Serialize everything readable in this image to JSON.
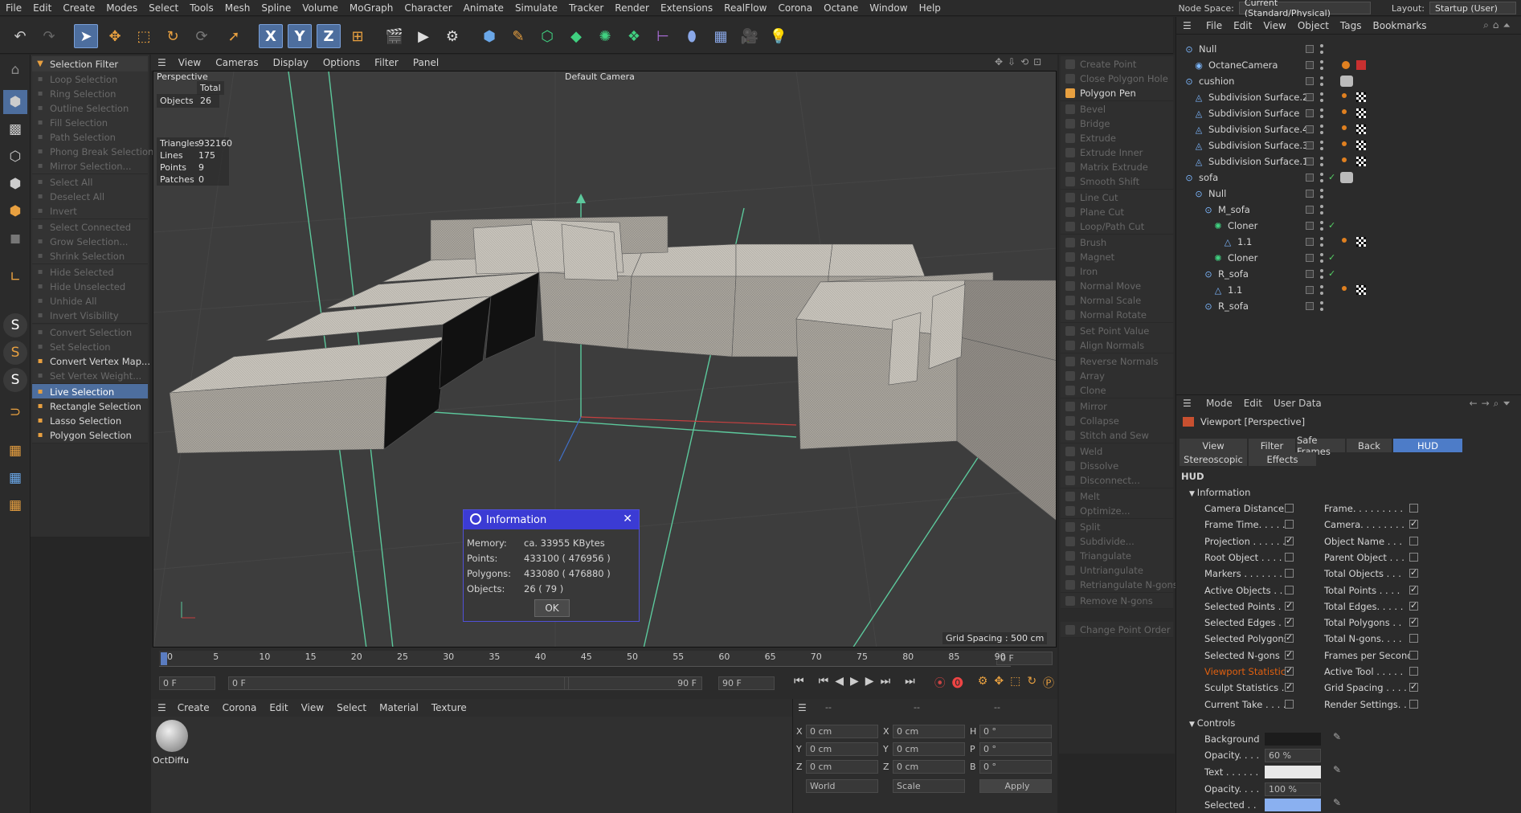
{
  "menu": [
    "File",
    "Edit",
    "Create",
    "Modes",
    "Select",
    "Tools",
    "Mesh",
    "Spline",
    "Volume",
    "MoGraph",
    "Character",
    "Animate",
    "Simulate",
    "Tracker",
    "Render",
    "Extensions",
    "RealFlow",
    "Corona",
    "Octane",
    "Window",
    "Help"
  ],
  "nodespace": {
    "label": "Node Space:",
    "value": "Current (Standard/Physical)"
  },
  "layout": {
    "label": "Layout:",
    "value": "Startup (User)"
  },
  "selection": {
    "filter": "Selection Filter",
    "items": [
      {
        "label": "Loop Selection",
        "state": "dis"
      },
      {
        "label": "Ring Selection",
        "state": "dis"
      },
      {
        "label": "Outline Selection",
        "state": "dis"
      },
      {
        "label": "Fill Selection",
        "state": "dis"
      },
      {
        "label": "Path Selection",
        "state": "dis"
      },
      {
        "label": "Phong Break Selection",
        "state": "dis"
      },
      {
        "label": "Mirror Selection...",
        "state": "dis"
      },
      {
        "label": "Select All",
        "state": "dis"
      },
      {
        "label": "Deselect All",
        "state": "dis"
      },
      {
        "label": "Invert",
        "state": "dis"
      },
      {
        "label": "Select Connected",
        "state": "dis"
      },
      {
        "label": "Grow Selection...",
        "state": "dis"
      },
      {
        "label": "Shrink Selection",
        "state": "dis"
      },
      {
        "label": "Hide Selected",
        "state": "dis"
      },
      {
        "label": "Hide Unselected",
        "state": "dis"
      },
      {
        "label": "Unhide All",
        "state": "dis"
      },
      {
        "label": "Invert Visibility",
        "state": "dis"
      },
      {
        "label": "Convert Selection",
        "state": "dis"
      },
      {
        "label": "Set Selection",
        "state": "dis"
      },
      {
        "label": "Convert Vertex Map...",
        "state": "en"
      },
      {
        "label": "Set Vertex Weight...",
        "state": "dis"
      },
      {
        "label": "Live Selection",
        "state": "act"
      },
      {
        "label": "Rectangle Selection",
        "state": "en"
      },
      {
        "label": "Lasso Selection",
        "state": "en"
      },
      {
        "label": "Polygon Selection",
        "state": "en"
      }
    ]
  },
  "viewmenu": [
    "View",
    "Cameras",
    "Display",
    "Options",
    "Filter",
    "Panel"
  ],
  "viewport": {
    "name": "Perspective",
    "camera": "Default Camera",
    "total_label": "Total",
    "objects_label": "Objects",
    "objects": "26",
    "triangles_label": "Triangles",
    "triangles": "932160",
    "lines_label": "Lines",
    "lines": "175",
    "points_label": "Points",
    "points": "9",
    "patches_label": "Patches",
    "patches": "0",
    "grid": "Grid Spacing : 500 cm"
  },
  "dialog": {
    "title": "Information",
    "memory_label": "Memory:",
    "memory": "ca. 33955 KBytes",
    "points_label": "Points:",
    "points": "433100 ( 476956 )",
    "polygons_label": "Polygons:",
    "polygons": "433080 ( 476880 )",
    "objects_label": "Objects:",
    "objects": "26 ( 79 )",
    "ok": "OK"
  },
  "timeline": {
    "ticks": [
      "0",
      "5",
      "10",
      "15",
      "20",
      "25",
      "30",
      "35",
      "40",
      "45",
      "50",
      "55",
      "60",
      "65",
      "70",
      "75",
      "80",
      "85",
      "90"
    ],
    "current": "0 F",
    "start": "0 F",
    "start2": "0 F",
    "end": "90 F",
    "end2": "90 F"
  },
  "matmenu": [
    "Create",
    "Corona",
    "Edit",
    "View",
    "Select",
    "Material",
    "Texture"
  ],
  "material": {
    "name": "OctDiffu"
  },
  "coords": {
    "x": "0 cm",
    "y": "0 cm",
    "z": "0 cm",
    "sx": "0 cm",
    "sy": "0 cm",
    "sz": "0 cm",
    "h": "0 °",
    "p": "0 °",
    "b": "0 °",
    "world": "World",
    "scale": "Scale",
    "apply": "Apply",
    "dash1": "--",
    "dash2": "--",
    "dash3": "--"
  },
  "tools": [
    {
      "label": "Create Point",
      "en": false
    },
    {
      "label": "Close Polygon Hole",
      "en": false
    },
    {
      "label": "Polygon Pen",
      "en": true
    },
    {
      "label": "Bevel",
      "en": false
    },
    {
      "label": "Bridge",
      "en": false
    },
    {
      "label": "Extrude",
      "en": false
    },
    {
      "label": "Extrude Inner",
      "en": false
    },
    {
      "label": "Matrix Extrude",
      "en": false
    },
    {
      "label": "Smooth Shift",
      "en": false
    },
    {
      "label": "Line Cut",
      "en": false
    },
    {
      "label": "Plane Cut",
      "en": false
    },
    {
      "label": "Loop/Path Cut",
      "en": false
    },
    {
      "label": "Brush",
      "en": false
    },
    {
      "label": "Magnet",
      "en": false
    },
    {
      "label": "Iron",
      "en": false
    },
    {
      "label": "Normal Move",
      "en": false
    },
    {
      "label": "Normal Scale",
      "en": false
    },
    {
      "label": "Normal Rotate",
      "en": false
    },
    {
      "label": "Set Point Value",
      "en": false
    },
    {
      "label": "Align Normals",
      "en": false
    },
    {
      "label": "Reverse Normals",
      "en": false
    },
    {
      "label": "Array",
      "en": false
    },
    {
      "label": "Clone",
      "en": false
    },
    {
      "label": "Mirror",
      "en": false
    },
    {
      "label": "Collapse",
      "en": false
    },
    {
      "label": "Stitch and Sew",
      "en": false
    },
    {
      "label": "Weld",
      "en": false
    },
    {
      "label": "Dissolve",
      "en": false
    },
    {
      "label": "Disconnect...",
      "en": false
    },
    {
      "label": "Melt",
      "en": false
    },
    {
      "label": "Optimize...",
      "en": false
    },
    {
      "label": "Split",
      "en": false
    },
    {
      "label": "Subdivide...",
      "en": false
    },
    {
      "label": "Triangulate",
      "en": false
    },
    {
      "label": "Untriangulate",
      "en": false
    },
    {
      "label": "Retriangulate N-gons",
      "en": false
    },
    {
      "label": "Remove N-gons",
      "en": false
    },
    {
      "label": "Change Point Order",
      "en": false
    }
  ],
  "objmenu": [
    "File",
    "Edit",
    "View",
    "Object",
    "Tags",
    "Bookmarks"
  ],
  "objects": [
    {
      "name": "Null",
      "indent": 0
    },
    {
      "name": "OctaneCamera",
      "indent": 1
    },
    {
      "name": "cushion",
      "indent": 0
    },
    {
      "name": "Subdivision Surface.2",
      "indent": 1
    },
    {
      "name": "Subdivision Surface",
      "indent": 1
    },
    {
      "name": "Subdivision Surface.4",
      "indent": 1
    },
    {
      "name": "Subdivision Surface.3",
      "indent": 1
    },
    {
      "name": "Subdivision Surface.1",
      "indent": 1
    },
    {
      "name": "sofa",
      "indent": 0
    },
    {
      "name": "Null",
      "indent": 1
    },
    {
      "name": "M_sofa",
      "indent": 2
    },
    {
      "name": "Cloner",
      "indent": 3
    },
    {
      "name": "1.1",
      "indent": 4
    },
    {
      "name": "Cloner",
      "indent": 3
    },
    {
      "name": "R_sofa",
      "indent": 2
    },
    {
      "name": "1.1",
      "indent": 3
    },
    {
      "name": "R_sofa",
      "indent": 2
    }
  ],
  "attr": {
    "menu": [
      "Mode",
      "Edit",
      "User Data"
    ],
    "title": "Viewport [Perspective]",
    "tabs": [
      "View",
      "Filter",
      "Safe Frames",
      "Back",
      "HUD"
    ],
    "tabs2": [
      "Stereoscopic",
      "Effects"
    ],
    "section": "HUD",
    "info": "Information",
    "controls": "Controls",
    "left": [
      {
        "l": "Camera Distance",
        "c": false
      },
      {
        "l": "Frame Time. . . . .",
        "c": false
      },
      {
        "l": "Projection . . . . . .",
        "c": true
      },
      {
        "l": "Root Object . . . .",
        "c": false
      },
      {
        "l": "Markers . . . . . . .",
        "c": false
      },
      {
        "l": "Active Objects . .",
        "c": false
      },
      {
        "l": "Selected Points . .",
        "c": true
      },
      {
        "l": "Selected Edges . .",
        "c": true
      },
      {
        "l": "Selected Polygons",
        "c": true
      },
      {
        "l": "Selected N-gons",
        "c": true
      },
      {
        "l": "Viewport Statistics",
        "c": true,
        "hl": true
      },
      {
        "l": "Sculpt Statistics . .",
        "c": true
      },
      {
        "l": "Current Take . . . .",
        "c": false
      }
    ],
    "right": [
      {
        "l": "Frame. . . . . . . . .",
        "c": false
      },
      {
        "l": "Camera. . . . . . . .",
        "c": true
      },
      {
        "l": "Object Name . . .",
        "c": false
      },
      {
        "l": "Parent Object . . .",
        "c": false
      },
      {
        "l": "Total Objects . . .",
        "c": true
      },
      {
        "l": "Total Points . . . .",
        "c": true
      },
      {
        "l": "Total Edges. . . . .",
        "c": true
      },
      {
        "l": "Total Polygons . .",
        "c": true
      },
      {
        "l": "Total N-gons. . . .",
        "c": false
      },
      {
        "l": "Frames per Second",
        "c": false
      },
      {
        "l": "Active Tool . . . . .",
        "c": false
      },
      {
        "l": "Grid Spacing . . . .",
        "c": true
      },
      {
        "l": "Render Settings. .",
        "c": false
      }
    ],
    "bg_label": "Background",
    "opacity_label": "Opacity. . . .",
    "opacity1": "60 %",
    "text_label": "Text . . . . . .",
    "opacity2": "100 %",
    "selected_label": "Selected . ."
  },
  "colors": {
    "accent": "#4d7cc8",
    "selected": "#4d6e9e",
    "highlight": "#e06010"
  }
}
